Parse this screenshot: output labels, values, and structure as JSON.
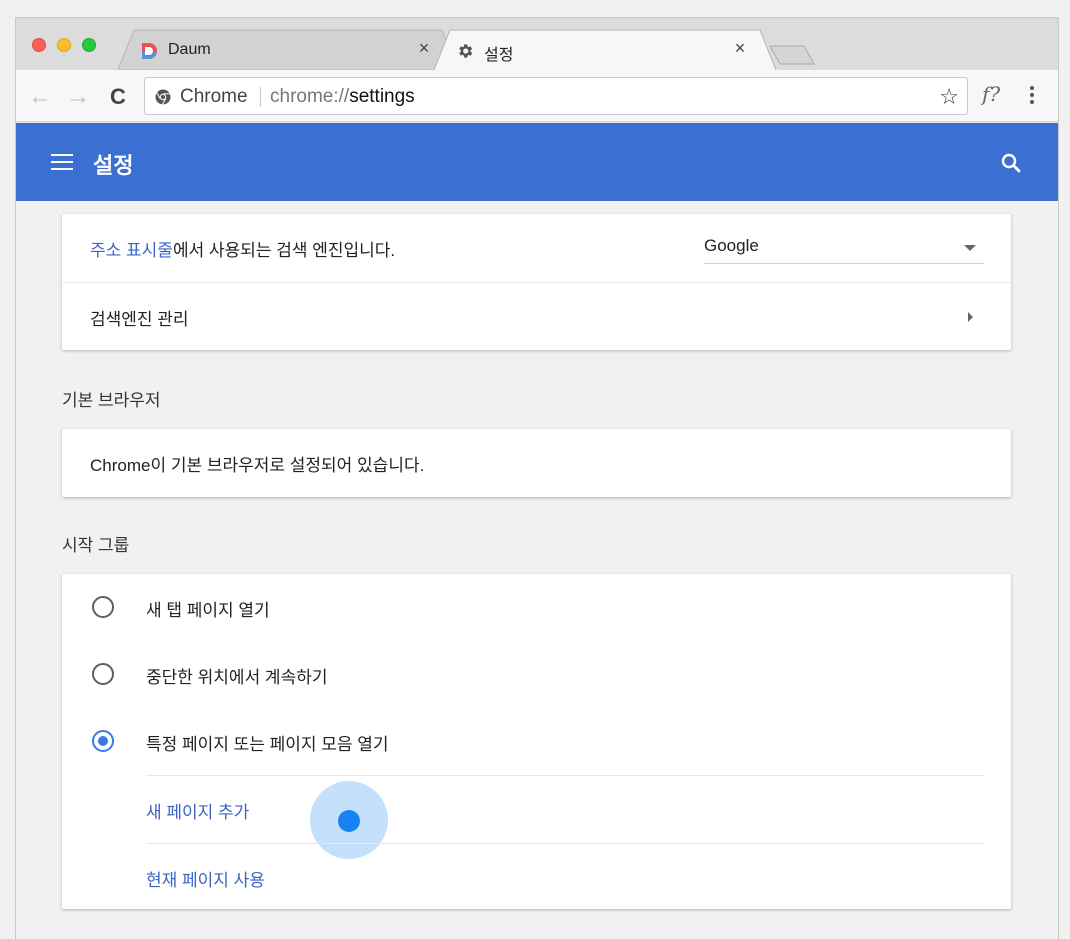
{
  "tabs": [
    {
      "title": "Daum",
      "close": "×"
    },
    {
      "title": "설정",
      "close": "×"
    }
  ],
  "toolbar": {
    "back": "←",
    "forward": "→",
    "reload": "C",
    "site_name": "Chrome",
    "url_prefix": "chrome://",
    "url_path": "settings",
    "bookmark": "☆",
    "extension": "f?"
  },
  "header": {
    "title": "설정"
  },
  "search_engine": {
    "description_link": "주소 표시줄",
    "description_rest": "에서 사용되는 검색 엔진입니다.",
    "selected": "Google",
    "manage_label": "검색엔진 관리"
  },
  "default_browser": {
    "section_title": "기본 브라우저",
    "status": "Chrome이 기본 브라우저로 설정되어 있습니다."
  },
  "startup": {
    "section_title": "시작 그룹",
    "options": [
      {
        "label": "새 탭 페이지 열기",
        "checked": false
      },
      {
        "label": "중단한 위치에서 계속하기",
        "checked": false
      },
      {
        "label": "특정 페이지 또는 페이지 모음 열기",
        "checked": true
      }
    ],
    "add_page": "새 페이지 추가",
    "use_current": "현재 페이지 사용"
  },
  "colors": {
    "header_bg": "#3b6fd2",
    "link": "#3a64c6",
    "radio_checked": "#3b78e7"
  }
}
